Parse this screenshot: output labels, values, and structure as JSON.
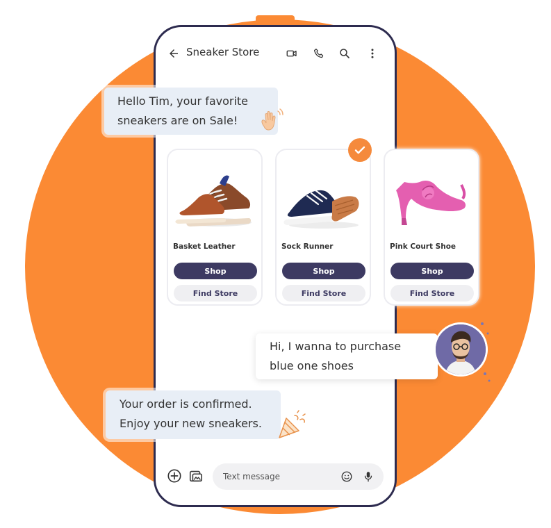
{
  "header": {
    "title": "Sneaker Store",
    "icons": [
      "back-arrow-icon",
      "video-call-icon",
      "phone-icon",
      "search-icon",
      "more-vert-icon"
    ]
  },
  "messages": {
    "incoming_greeting": [
      "Hello Tim, your favorite",
      "sneakers are on Sale!"
    ],
    "outgoing_reply": [
      "Hi, I wanna to purchase",
      "blue one shoes"
    ],
    "incoming_confirmation": [
      "Your order is confirmed.",
      "Enjoy your new sneakers."
    ]
  },
  "products": [
    {
      "name": "Basket Leather",
      "shop_label": "Shop",
      "find_label": "Find Store"
    },
    {
      "name": "Sock Runner",
      "shop_label": "Shop",
      "find_label": "Find Store",
      "selected": true
    },
    {
      "name": "Pink Court Shoe",
      "shop_label": "Shop",
      "find_label": "Find Store"
    }
  ],
  "composer": {
    "placeholder": "Text message",
    "icons": [
      "add-circle-icon",
      "gallery-icon",
      "emoji-icon",
      "microphone-icon"
    ]
  },
  "colors": {
    "background_accent": "#fb8a34",
    "phone_frame": "#2d2b4f",
    "shop_button": "#3d3a62",
    "check_badge": "#f58a3c"
  }
}
